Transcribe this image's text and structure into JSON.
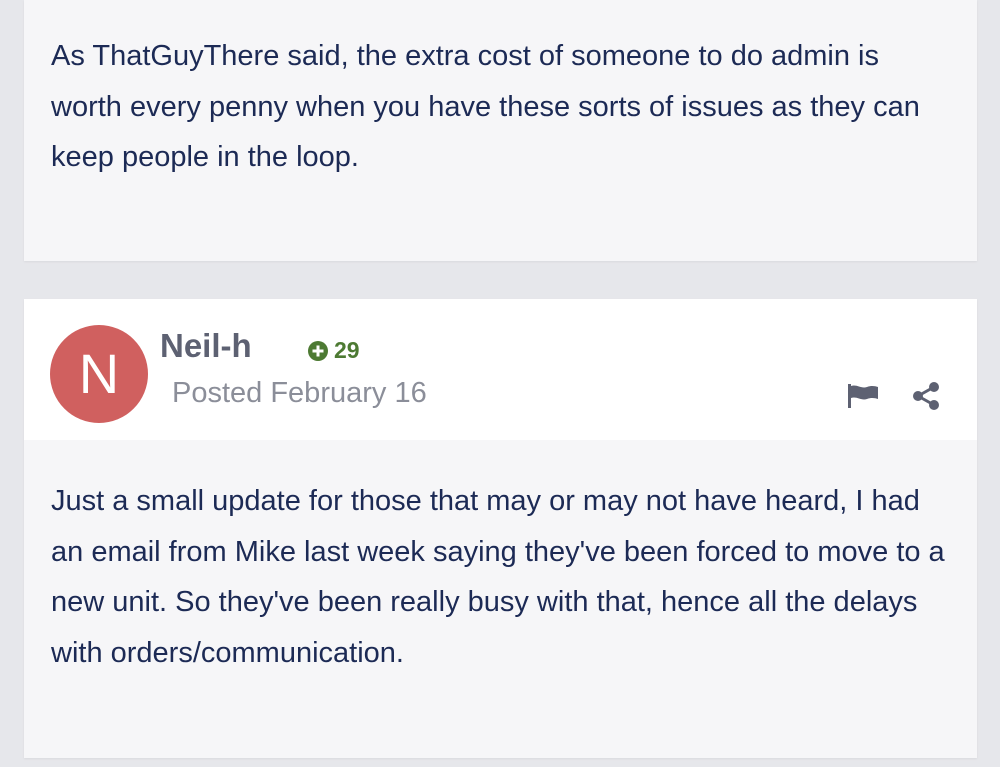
{
  "previous_post": {
    "body": "As ThatGuyThere said, the extra cost of someone to do admin is worth every penny when you have these sorts of issues as they can keep people in the loop."
  },
  "post": {
    "avatar_letter": "N",
    "author": "Neil-h",
    "reputation": "29",
    "posted_label": "Posted February 16",
    "body": "Just a small update for those that may or may not have heard, I had an email from Mike last week saying they've been forced to move to a new unit. So they've been really busy with that, hence all the delays with orders/communication.",
    "actions": {
      "report_icon": "flag-icon",
      "share_icon": "share-icon"
    }
  },
  "colors": {
    "page_background": "#e6e7eb",
    "card_background": "#f6f6f8",
    "header_background": "#ffffff",
    "body_text": "#1c2a55",
    "avatar": "#d0605f",
    "author": "#5d6172",
    "reputation": "#4d7a33",
    "meta": "#8b8e99"
  }
}
